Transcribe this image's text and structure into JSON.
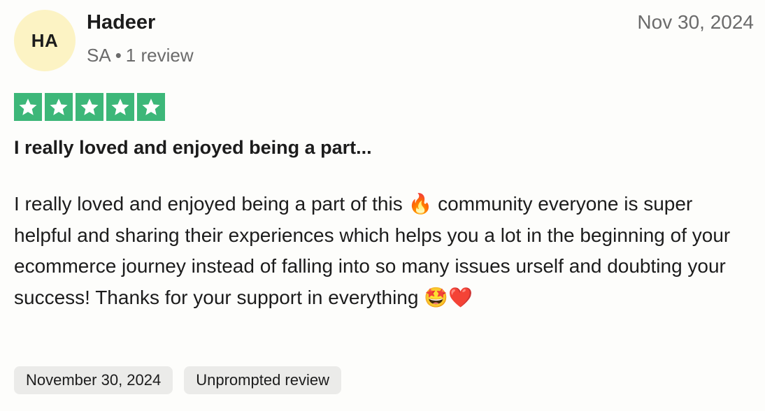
{
  "reviewer": {
    "initials": "HA",
    "name": "Hadeer",
    "country": "SA",
    "separator": "•",
    "review_count": "1 review"
  },
  "review_date_header": "Nov 30, 2024",
  "rating": {
    "stars": 5,
    "max": 5,
    "color": "#3db779"
  },
  "review": {
    "title": "I really loved and enjoyed being a part...",
    "body": "I really loved and enjoyed being a part of this 🔥 community everyone is super helpful and sharing their experiences which helps you a lot in the beginning of your ecommerce journey instead of falling into so many issues urself and doubting your success! Thanks for your support in everything 🤩❤️"
  },
  "tags": {
    "date_of_experience": "November 30, 2024",
    "review_type": "Unprompted review"
  }
}
